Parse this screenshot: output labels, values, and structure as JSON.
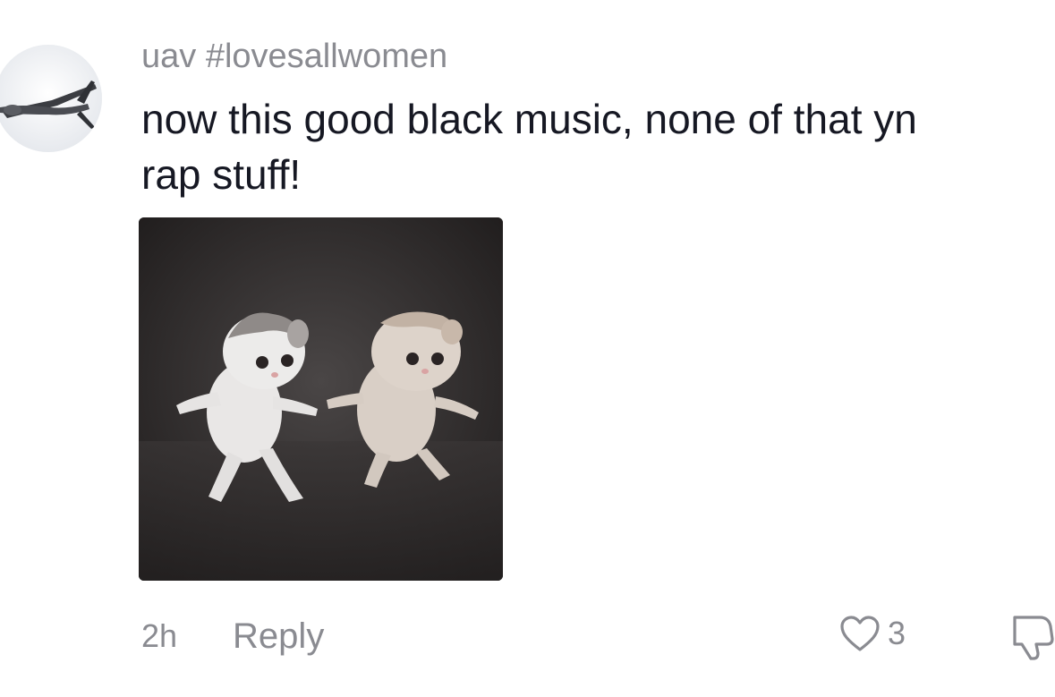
{
  "comment": {
    "username": "uav #lovesallwomen",
    "text_lines": [
      "now this good black music, none of that yn",
      "rap stuff!"
    ],
    "timestamp": "2h",
    "reply_label": "Reply",
    "like_count": "3",
    "avatar_icon": "drone-aircraft-icon",
    "media_description_icon": "dancing-kittens-image"
  },
  "colors": {
    "muted_text": "#8a8b91",
    "primary_text": "#161823",
    "background": "#ffffff"
  }
}
